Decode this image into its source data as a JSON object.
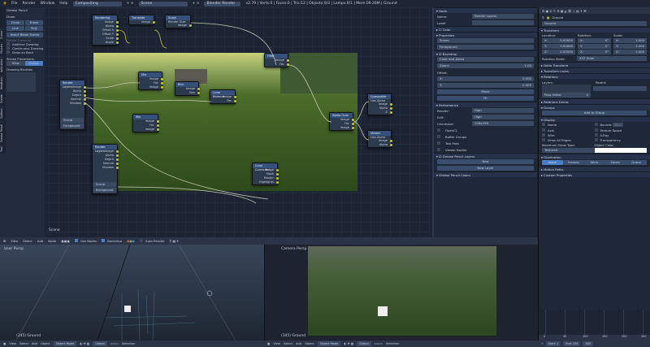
{
  "topbar": {
    "menus": [
      "File",
      "Render",
      "Window",
      "Help"
    ],
    "layout": "Compositing",
    "scene": "Scene",
    "engine": "Blender Render",
    "stats": "v2.79 | Verts:0 | Faces:0 | Tris:12 | Objects:0/3 | Lamps:0/1 | Mem:09.26M | Ground"
  },
  "toolshelf": {
    "title": "Grease Pencil",
    "draw_label": "Draw:",
    "draw": "Draw",
    "erase": "Erase",
    "line": "Line",
    "poly": "Poly",
    "insert_frame": "Insert Blank Frame",
    "delete_frame": "Delete Frame(s)",
    "options": [
      "Additive Drawing",
      "Continuous Drawing",
      "Draw on Back"
    ],
    "stroke_placement": "Stroke Placement:",
    "view": "View",
    "cursor": "Cursor",
    "brushes": "Drawing Brushes",
    "tabs": [
      "Tool",
      "Grease Pencil",
      "Options",
      "Create",
      "Relations",
      "Animation",
      "Physics",
      "Scene"
    ]
  },
  "nodes": [
    {
      "title": "Rendering",
      "sockets": [
        "Image",
        "Alpha",
        "Offset X",
        "Offset Y",
        "Scale",
        "Angle"
      ]
    },
    {
      "title": "Render Layers",
      "sockets": [
        "Image",
        "Alpha",
        "Depth",
        "Normal",
        "Shadow"
      ],
      "scene": "Scene",
      "layer": "Foreground"
    },
    {
      "title": "Render Layers",
      "sockets": [
        "Image",
        "Alpha",
        "Depth",
        "Normal",
        "Shadow"
      ],
      "scene": "Scene",
      "layer": "Background"
    },
    {
      "title": "Translate",
      "sockets": [
        "Image"
      ]
    },
    {
      "title": "Scale",
      "sockets": [
        "Image"
      ],
      "option": "Render Size"
    },
    {
      "title": "Mix",
      "sockets": [
        "Image",
        "Fac",
        "Image"
      ]
    },
    {
      "title": "Blur",
      "sockets": [
        "Image",
        "Size"
      ]
    },
    {
      "title": "Color Balance",
      "sockets": [
        "Image",
        "Fac"
      ]
    },
    {
      "title": "Mix",
      "sockets": [
        "Image",
        "Fac",
        "Image"
      ]
    },
    {
      "title": "Alpha Over",
      "sockets": [
        "Image",
        "Fac",
        "Image"
      ]
    },
    {
      "title": "Composite",
      "sockets": [
        "Image",
        "Alpha",
        "Z"
      ],
      "option": "Use Alpha"
    },
    {
      "title": "Viewer",
      "sockets": [
        "Image",
        "Alpha"
      ],
      "option": "Use Alpha"
    },
    {
      "title": "Color Correction",
      "sockets": [
        "Image",
        "Mask",
        "Master",
        "Highlights"
      ]
    },
    {
      "title": "Filter",
      "sockets": [
        "Image",
        "Fac"
      ]
    }
  ],
  "editor_footer": "Scene",
  "node_props": {
    "node_title": "Node",
    "name_label": "Name:",
    "name": "Render Layers",
    "label_label": "Label:",
    "color": "Color",
    "properties": "Properties",
    "scene": "Scene",
    "layer": "Foreground",
    "backdrop": "Backdrop",
    "channels": "Color and Alpha",
    "zoom_label": "Zoom:",
    "zoom": "1.00",
    "offset": "Offset:",
    "x_label": "X:",
    "x": "0.000",
    "y_label": "Y:",
    "y": "0.000",
    "move": "Move",
    "fit": "Fit",
    "performance": "Performance",
    "render_label": "Render:",
    "render": "High",
    "edit_label": "Edit:",
    "edit": "High",
    "chunksize_label": "Chunksize:",
    "chunksize": "256x256",
    "checks": [
      "OpenCL",
      "Buffer Groups",
      "Two Pass",
      "Viewer Border"
    ],
    "gp_layers": "Grease Pencil Layers",
    "new": "New",
    "new_layer": "New Layer",
    "gp_colors": "Grease Pencil Colors"
  },
  "obj_props": {
    "object": "Ground",
    "name": "Ground",
    "transform": "Transform",
    "location": "Location:",
    "rotation": "Rotation:",
    "scale": "Scale:",
    "loc": [
      "X:",
      "0.00000",
      "Y:",
      "0.00000",
      "Z:",
      "0.00000"
    ],
    "rot": [
      "X:",
      "0°",
      "Y:",
      "0°",
      "Z:",
      "0°"
    ],
    "scl": [
      "X:",
      "1.000",
      "Y:",
      "1.000",
      "Z:",
      "1.000"
    ],
    "rot_mode_label": "Rotation Mode:",
    "rot_mode": "XYZ Euler",
    "delta": "Delta Transform",
    "locks": "Transform Locks",
    "relations": "Relations",
    "layers": "Layers:",
    "parent": "Parent:",
    "pass_index": "Pass Index:",
    "pass_value": "0",
    "rel_extras": "Relations Extras",
    "groups": "Groups",
    "add_group": "Add to Group",
    "display": "Display",
    "display_left": [
      "Name",
      "Axis",
      "Wire",
      "Draw All Edges"
    ],
    "display_right": [
      "Bounds",
      "Texture Space",
      "X-Ray",
      "Transparency"
    ],
    "bounds_type": "Box",
    "max_draw_label": "Maximum Draw Type:",
    "max_draw": "Textured",
    "obj_color_label": "Object Color:",
    "duplication": "Duplication",
    "dup_options": [
      "None",
      "Frames",
      "Verts",
      "Faces",
      "Group"
    ],
    "motion_paths": "Motion Paths",
    "custom_props": "Custom Properties"
  },
  "node_header": {
    "menus": [
      "View",
      "Select",
      "Add",
      "Node"
    ],
    "use_nodes": "Use Nodes",
    "backdrop": "Backdrop",
    "auto_render": "Auto Render"
  },
  "viewports": [
    {
      "label": "User Persp",
      "object": "(345) Ground",
      "menus": [
        "View",
        "Select",
        "Add",
        "Object"
      ],
      "mode": "Object Mode",
      "pivot": "Global",
      "snap": "Selection"
    },
    {
      "label": "Camera Persp",
      "object": "(345) Ground",
      "menus": [
        "View",
        "Select",
        "Add",
        "Object"
      ],
      "mode": "Object Mode",
      "pivot": "Global",
      "snap": "Selection"
    }
  ],
  "timeline": {
    "ticks": [
      "0",
      "50",
      "100",
      "150",
      "200",
      "250"
    ],
    "start": "Start: 1",
    "end": "End: 250",
    "current": "345",
    "menus": [
      "View",
      "Marker",
      "Frame",
      "Playback"
    ]
  }
}
